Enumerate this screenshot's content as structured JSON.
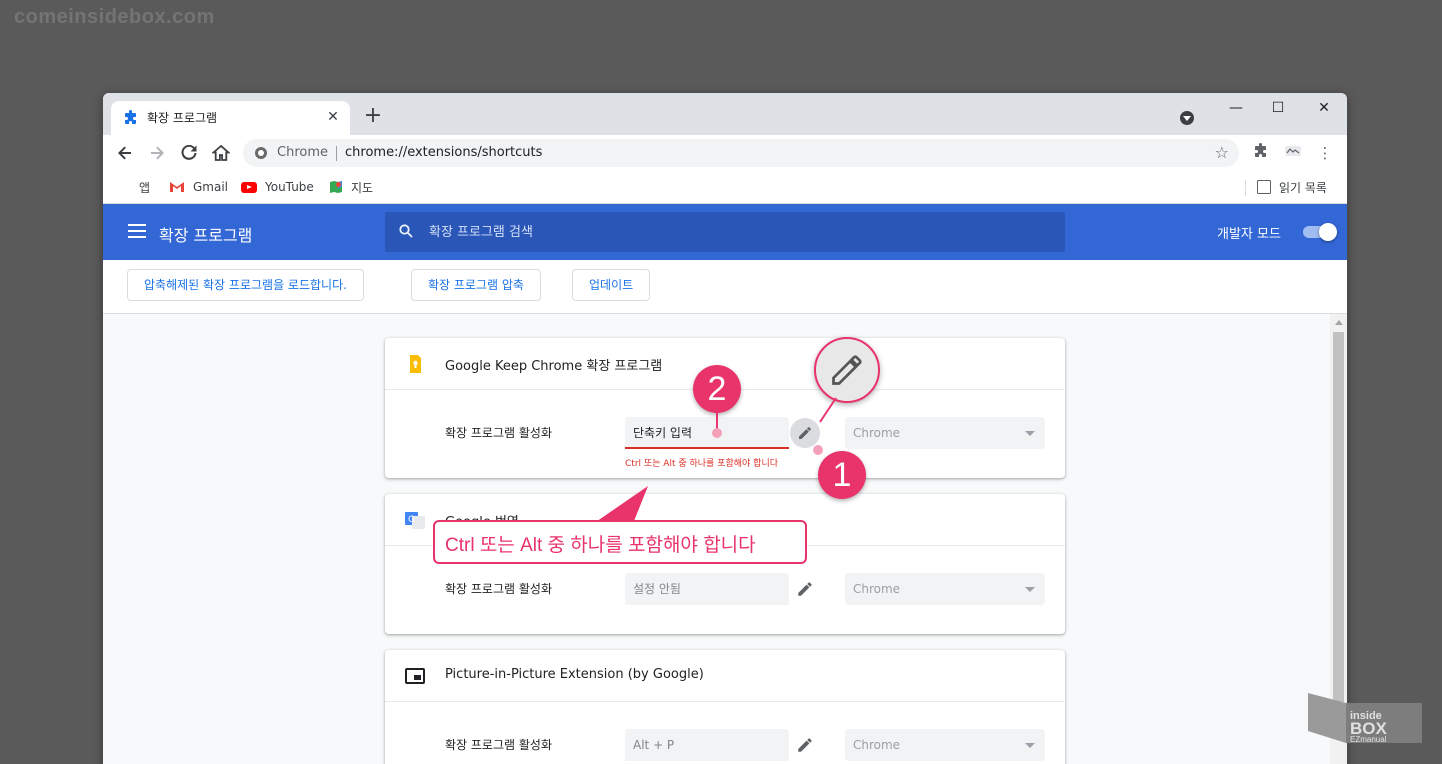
{
  "watermark": "comeinsidebox.com",
  "browser": {
    "tab": {
      "title": "확장 프로그램",
      "close": "✕"
    },
    "new_tab": "+",
    "window_controls": {
      "minimize": "—",
      "maximize": "☐",
      "close": "✕"
    },
    "omnibox": {
      "site_label": "Chrome",
      "url": "chrome://extensions/shortcuts"
    },
    "bookmarks": [
      {
        "label": "앱",
        "icon": "apps-grid-icon"
      },
      {
        "label": "Gmail",
        "icon": "gmail-icon"
      },
      {
        "label": "YouTube",
        "icon": "youtube-icon"
      },
      {
        "label": "지도",
        "icon": "maps-icon"
      }
    ],
    "reading_list": "읽기 목록"
  },
  "extensions_page": {
    "header_title": "확장 프로그램",
    "search_placeholder": "확장 프로그램 검색",
    "dev_mode_label": "개발자 모드",
    "dev_mode_on": true,
    "actions": [
      "압축해제된 확장 프로그램을 로드합니다.",
      "확장 프로그램 압축",
      "업데이트"
    ],
    "cards": [
      {
        "title": "Google Keep Chrome 확장 프로그램",
        "row_label": "확장 프로그램 활성화",
        "shortcut": "단축키 입력",
        "scope": "Chrome",
        "error": "Ctrl 또는 Alt 중 하나를 포함해야 합니다"
      },
      {
        "title": "Google 번역",
        "row_label": "확장 프로그램 활성화",
        "shortcut": "설정 안됨",
        "scope": "Chrome"
      },
      {
        "title": "Picture-in-Picture Extension (by Google)",
        "row_label": "확장 프로그램 활성화",
        "shortcut": "Alt + P",
        "scope": "Chrome"
      }
    ]
  },
  "annotations": {
    "badge_1": "1",
    "badge_2": "2",
    "tooltip": "Ctrl 또는 Alt 중 하나를 포함해야 합니다"
  },
  "colors": {
    "header_blue": "#3367d6",
    "accent_pink": "#e8336b",
    "error_red": "#d93025"
  }
}
